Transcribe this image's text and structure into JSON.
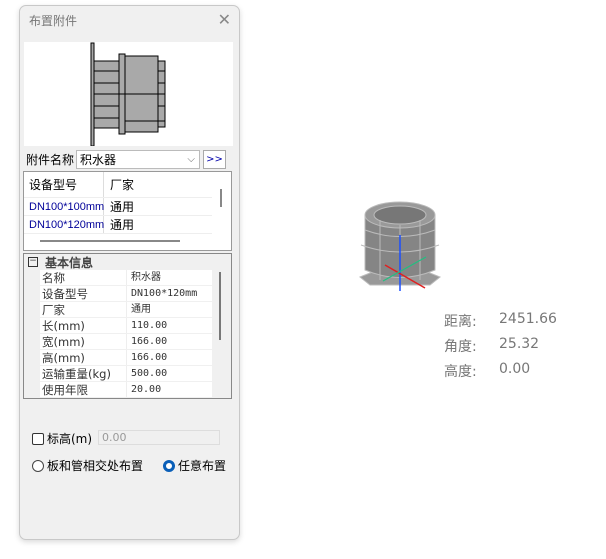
{
  "dialog": {
    "title": "布置附件",
    "close_icon": "close-icon"
  },
  "attachment": {
    "label": "附件名称",
    "value": "积水器",
    "more_label": ">>"
  },
  "spec_table": {
    "columns": [
      "设备型号",
      "厂家"
    ],
    "rows": [
      [
        "DN100*100mm",
        "通用"
      ],
      [
        "DN100*120mm",
        "通用"
      ]
    ]
  },
  "properties": {
    "section": "基本信息",
    "toggle": "⊟",
    "rows": [
      [
        "名称",
        "积水器"
      ],
      [
        "设备型号",
        "DN100*120mm"
      ],
      [
        "厂家",
        "通用"
      ],
      [
        "长(mm)",
        "110.00"
      ],
      [
        "宽(mm)",
        "166.00"
      ],
      [
        "高(mm)",
        "166.00"
      ],
      [
        "运输重量(kg)",
        "500.00"
      ],
      [
        "使用年限",
        "20.00"
      ]
    ]
  },
  "elevation": {
    "label": "标高(m)",
    "checked": false,
    "value": "0.00"
  },
  "placement": {
    "options": [
      "板和管相交处布置",
      "任意布置"
    ],
    "selected": "任意布置"
  },
  "readout": {
    "distance_label": "距离:",
    "distance": "2451.66",
    "angle_label": "角度:",
    "angle": "25.32",
    "height_label": "高度:",
    "height": "0.00"
  },
  "colors": {
    "accent": "#0a5fb8",
    "axis_z": "#1a4fff",
    "axis_x": "#e02020",
    "axis_y": "#20c080"
  }
}
